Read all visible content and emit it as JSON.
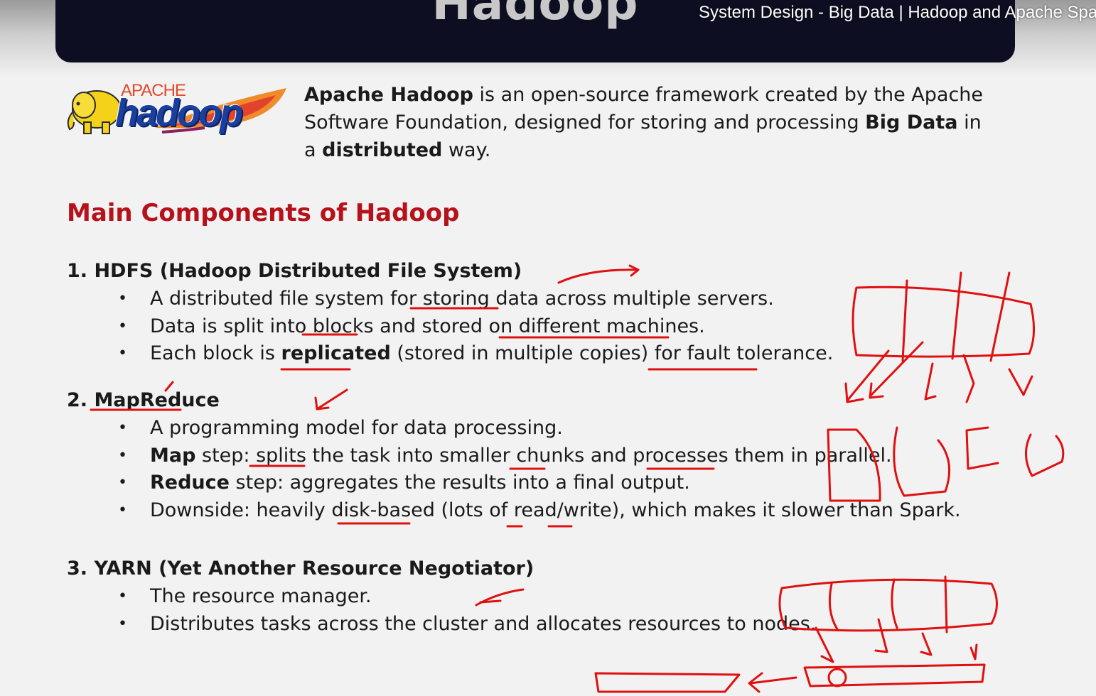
{
  "video_title": "System Design - Big Data | Hadoop and Apache Spa",
  "slide_title": "Hadoop",
  "logo": {
    "apache": "APACHE",
    "hadoop": "hadoop"
  },
  "intro": {
    "t1_bold": "Apache Hadoop",
    "t2": " is an open-source framework created by the Apache Software Foundation, designed for storing and processing ",
    "t3_bold": "Big Data",
    "t4": " in a ",
    "t5_bold": "distributed",
    "t6": " way."
  },
  "section_heading": "Main Components of Hadoop",
  "components": [
    {
      "title": "1. HDFS (Hadoop Distributed File System)",
      "bullets": [
        {
          "text": "A distributed file system for storing data across multiple servers."
        },
        {
          "text": "Data is split into blocks and stored on different machines."
        },
        {
          "pre": "Each block is ",
          "bold": "replicated",
          "post": " (stored in multiple copies) for fault tolerance."
        }
      ]
    },
    {
      "title": "2. MapReduce",
      "bullets": [
        {
          "text": "A programming model for data processing."
        },
        {
          "bold": "Map",
          "post": " step: splits the task into smaller chunks and processes them in parallel."
        },
        {
          "bold": "Reduce",
          "post": " step: aggregates the results into a final output."
        },
        {
          "text": "Downside: heavily disk-based (lots of read/write), which makes it slower than Spark."
        }
      ]
    },
    {
      "title": "3. YARN (Yet Another Resource Negotiator)",
      "bullets": [
        {
          "text": "The resource manager."
        },
        {
          "text": "Distributes tasks across the cluster and allocates resources to nodes."
        }
      ]
    }
  ],
  "colors": {
    "title_bar": "#0e0e22",
    "heading_red": "#b5121b",
    "annotation_red": "#e01010",
    "logo_blue": "#1b3f9e",
    "elephant_yellow": "#f5d21a"
  },
  "icons": {
    "logo_mascot": "elephant-icon",
    "logo_feather": "feather-icon"
  }
}
